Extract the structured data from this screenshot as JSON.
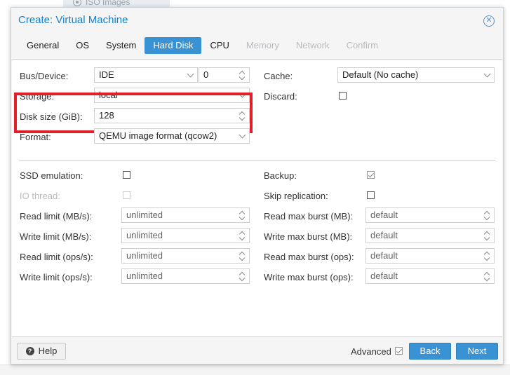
{
  "background": {
    "menu_item": "ISO Images"
  },
  "dialog": {
    "title": "Create: Virtual Machine",
    "tabs": [
      {
        "label": "General",
        "state": "normal"
      },
      {
        "label": "OS",
        "state": "normal"
      },
      {
        "label": "System",
        "state": "normal"
      },
      {
        "label": "Hard Disk",
        "state": "active"
      },
      {
        "label": "CPU",
        "state": "normal"
      },
      {
        "label": "Memory",
        "state": "disabled"
      },
      {
        "label": "Network",
        "state": "disabled"
      },
      {
        "label": "Confirm",
        "state": "disabled"
      }
    ]
  },
  "disk": {
    "bus_device_label": "Bus/Device:",
    "bus_value": "IDE",
    "device_value": "0",
    "storage_label": "Storage:",
    "storage_value": "local",
    "disk_size_label": "Disk size (GiB):",
    "disk_size_value": "128",
    "format_label": "Format:",
    "format_value": "QEMU image format (qcow2)",
    "cache_label": "Cache:",
    "cache_value": "Default (No cache)",
    "discard_label": "Discard:",
    "discard_checked": false
  },
  "advanced": {
    "ssd_emulation_label": "SSD emulation:",
    "ssd_checked": false,
    "io_thread_label": "IO thread:",
    "io_thread_checked": false,
    "backup_label": "Backup:",
    "backup_checked": true,
    "skip_replication_label": "Skip replication:",
    "skip_replication_checked": false,
    "left_limits": [
      {
        "label": "Read limit (MB/s):",
        "placeholder": "unlimited"
      },
      {
        "label": "Write limit (MB/s):",
        "placeholder": "unlimited"
      },
      {
        "label": "Read limit (ops/s):",
        "placeholder": "unlimited"
      },
      {
        "label": "Write limit (ops/s):",
        "placeholder": "unlimited"
      }
    ],
    "right_limits": [
      {
        "label": "Read max burst (MB):",
        "placeholder": "default"
      },
      {
        "label": "Write max burst (MB):",
        "placeholder": "default"
      },
      {
        "label": "Read max burst (ops):",
        "placeholder": "default"
      },
      {
        "label": "Write max burst (ops):",
        "placeholder": "default"
      }
    ]
  },
  "footer": {
    "help_label": "Help",
    "advanced_label": "Advanced",
    "advanced_checked": true,
    "back_label": "Back",
    "next_label": "Next"
  },
  "colors": {
    "accent": "#3892d4",
    "title": "#157fcc",
    "highlight": "#e0202a"
  }
}
